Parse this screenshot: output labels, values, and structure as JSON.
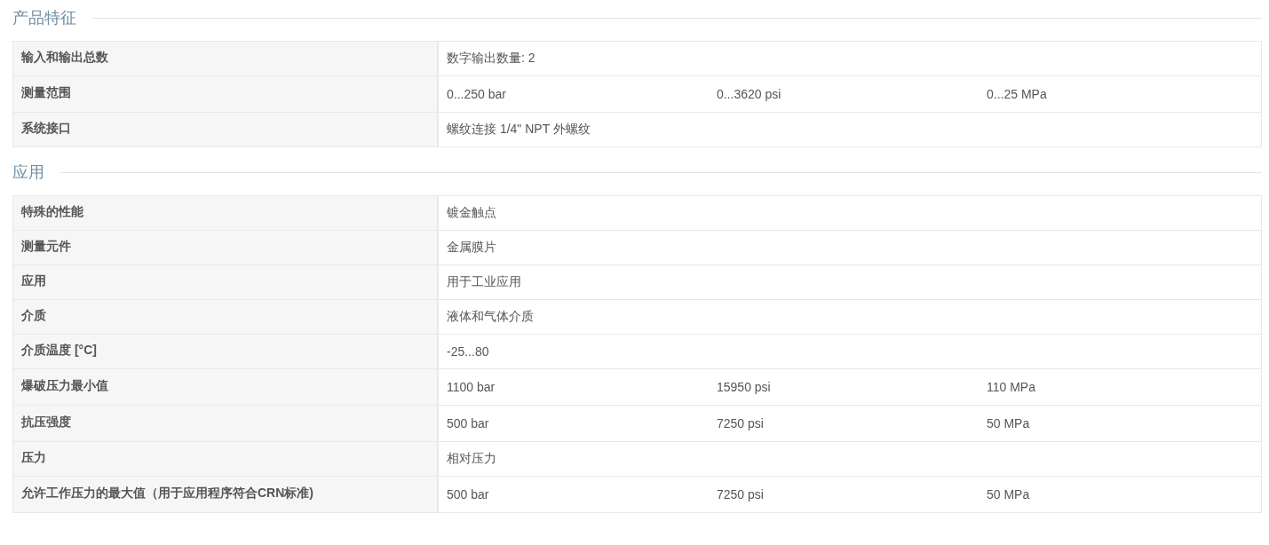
{
  "sections": [
    {
      "title": "产品特征",
      "rows": [
        {
          "label": "输入和输出总数",
          "values": [
            "数字输出数量: 2"
          ]
        },
        {
          "label": "测量范围",
          "values": [
            "0...250 bar",
            "0...3620 psi",
            "0...25 MPa"
          ]
        },
        {
          "label": "系统接口",
          "values": [
            "螺纹连接 1/4\" NPT 外螺纹"
          ]
        }
      ]
    },
    {
      "title": "应用",
      "rows": [
        {
          "label": "特殊的性能",
          "values": [
            "镀金触点"
          ]
        },
        {
          "label": "测量元件",
          "values": [
            "金属膜片"
          ]
        },
        {
          "label": "应用",
          "values": [
            "用于工业应用"
          ]
        },
        {
          "label": "介质",
          "values": [
            "液体和气体介质"
          ]
        },
        {
          "label": "介质温度 [°C]",
          "values": [
            "-25...80"
          ]
        },
        {
          "label": "爆破压力最小值",
          "values": [
            "1100 bar",
            "15950 psi",
            "110 MPa"
          ]
        },
        {
          "label": "抗压强度",
          "values": [
            "500 bar",
            "7250 psi",
            "50 MPa"
          ]
        },
        {
          "label": "压力",
          "values": [
            "相对压力"
          ]
        },
        {
          "label": "允许工作压力的最大值（用于应用程序符合CRN标准)",
          "values": [
            "500 bar",
            "7250 psi",
            "50 MPa"
          ]
        }
      ]
    }
  ]
}
